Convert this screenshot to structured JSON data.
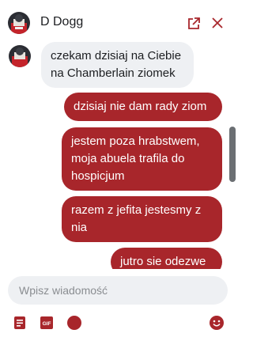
{
  "header": {
    "contact_name": "D Dogg",
    "avatar_icon": "profile-avatar",
    "open_icon": "external-link-icon",
    "close_icon": "close-icon"
  },
  "messages": [
    {
      "direction": "in",
      "text": "czekam dzisiaj na Ciebie na Chamberlain ziomek"
    },
    {
      "direction": "out",
      "text": "dzisiaj nie dam rady ziom"
    },
    {
      "direction": "out",
      "text": "jestem poza hrabstwem, moja abuela trafila do hospicjum"
    },
    {
      "direction": "out",
      "text": "razem z jefita jestesmy z nia"
    },
    {
      "direction": "out",
      "text": "jutro sie odezwe"
    }
  ],
  "composer": {
    "placeholder": "Wpisz wiadomość",
    "value": ""
  },
  "toolbar": {
    "note_icon": "document-icon",
    "gif_label": "GIF",
    "sticker_icon": "circle-sticker-icon",
    "emoji_icon": "emoji-icon"
  },
  "colors": {
    "accent": "#a8262b",
    "incoming_bubble": "#eef0f3",
    "text": "#1c1e21"
  }
}
